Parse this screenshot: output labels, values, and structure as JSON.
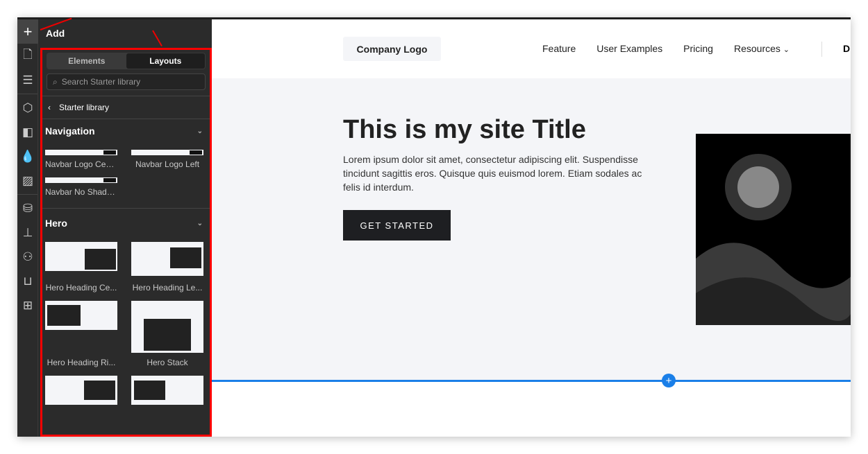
{
  "rail": {
    "icons": [
      "plus-icon",
      "page-icon",
      "navigator-icon",
      "box-icon",
      "style-icon",
      "color-drops-icon",
      "image-icon",
      "database-icon",
      "logic-icon",
      "user-icon",
      "basket-icon",
      "apps-icon"
    ]
  },
  "panel": {
    "title": "Add",
    "tabs": [
      "Elements",
      "Layouts"
    ],
    "active_tab": "Layouts",
    "search_placeholder": "Search Starter library",
    "breadcrumb": "Starter library",
    "sections": [
      {
        "title": "Navigation",
        "items": [
          "Navbar Logo Cen...",
          "Navbar Logo Left",
          "Navbar No Shadow"
        ]
      },
      {
        "title": "Hero",
        "items": [
          "Hero Heading Ce...",
          "Hero Heading Le...",
          "Hero Heading Ri...",
          "Hero Stack",
          "",
          ""
        ]
      }
    ]
  },
  "site": {
    "logo": "Company Logo",
    "nav": [
      "Feature",
      "User Examples",
      "Pricing",
      "Resources"
    ],
    "nav_cut": "D",
    "title": "This is my site Title",
    "body": "Lorem ipsum dolor sit amet, consectetur adipiscing elit. Suspendisse tincidunt sagittis eros. Quisque quis euismod lorem. Etiam sodales ac felis id interdum.",
    "cta": "GET STARTED"
  },
  "colors": {
    "accent": "#1a7fe8",
    "highlight": "#ff0000",
    "panel": "#2b2b2b"
  }
}
